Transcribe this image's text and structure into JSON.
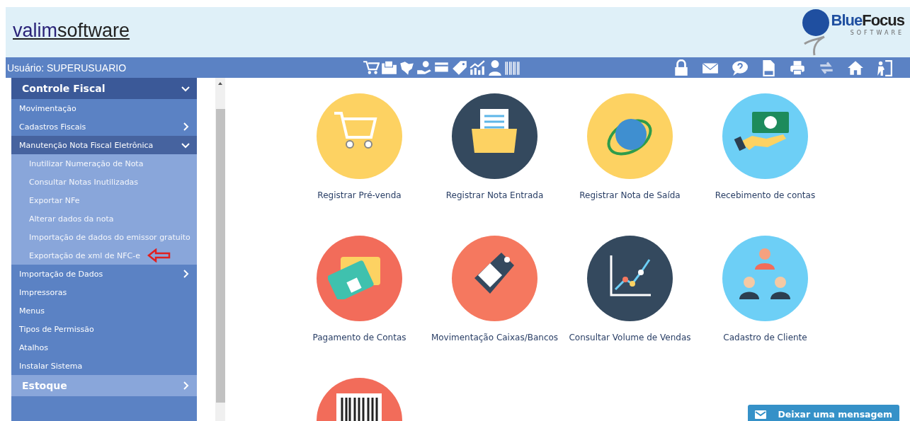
{
  "header": {
    "logo_left": {
      "part1": "valim",
      "part2": "software"
    },
    "logo_right": {
      "name_a": "Blue",
      "name_b": "Focus",
      "tagline": "SOFTWARE"
    }
  },
  "user_bar": {
    "user": "Usuário: SUPERUSUARIO",
    "center_icons": [
      {
        "kind": "cart"
      },
      {
        "kind": "folder"
      },
      {
        "kind": "map"
      },
      {
        "kind": "hand-coin"
      },
      {
        "kind": "card"
      },
      {
        "kind": "tag"
      },
      {
        "kind": "chart"
      },
      {
        "kind": "person"
      },
      {
        "kind": "barcode"
      }
    ],
    "right_icons": [
      {
        "kind": "lock"
      },
      {
        "kind": "mail"
      },
      {
        "kind": "help"
      },
      {
        "kind": "sql"
      },
      {
        "kind": "printer"
      },
      {
        "kind": "swap"
      },
      {
        "kind": "home"
      },
      {
        "kind": "exit"
      }
    ]
  },
  "sidebar": {
    "items": [
      {
        "kind": "section",
        "label": "Controle Fiscal",
        "expanded": true
      },
      {
        "kind": "item",
        "label": "Movimentação"
      },
      {
        "kind": "item",
        "label": "Cadastros Fiscais",
        "expanded": false
      },
      {
        "kind": "group",
        "label": "Manutenção Nota Fiscal Eletrônica",
        "expanded": true,
        "children": [
          {
            "label": "Inutilizar Numeração de Nota",
            "arrow": false
          },
          {
            "label": "Consultar Notas Inutilizadas",
            "arrow": false
          },
          {
            "label": "Exportar NFe",
            "arrow": false
          },
          {
            "label": "Alterar dados da nota",
            "arrow": false
          },
          {
            "label": "Importação de dados do emissor gratuito",
            "arrow": false
          },
          {
            "label": "Exportação de xml de NFC-e",
            "arrow": true
          }
        ]
      },
      {
        "kind": "item",
        "label": "Importação de Dados",
        "expanded": false
      },
      {
        "kind": "item",
        "label": "Impressoras"
      },
      {
        "kind": "item",
        "label": "Menus"
      },
      {
        "kind": "item",
        "label": "Tipos de Permissão"
      },
      {
        "kind": "item",
        "label": "Atalhos"
      },
      {
        "kind": "item",
        "label": "Instalar Sistema"
      },
      {
        "kind": "section",
        "label": "Estoque",
        "expanded": false
      }
    ]
  },
  "tiles": [
    {
      "kind": "cart",
      "label": "Registrar Pré-venda",
      "color": "#fdd262"
    },
    {
      "kind": "folder",
      "label": "Registrar Nota Entrada",
      "color": "#34495e"
    },
    {
      "kind": "nfe",
      "label": "Registrar Nota de Saída",
      "color": "#fdd262"
    },
    {
      "kind": "money",
      "label": "Recebimento de contas",
      "color": "#6dcff6"
    },
    {
      "kind": "card",
      "label": "Pagamento de Contas",
      "color": "#f26c5a"
    },
    {
      "kind": "tag",
      "label": "Movimentação Caixas/Bancos",
      "color": "#f5785f"
    },
    {
      "kind": "chart",
      "label": "Consultar Volume de Vendas",
      "color": "#34495e"
    },
    {
      "kind": "people",
      "label": "Cadastro de Cliente",
      "color": "#6dcff6"
    },
    {
      "kind": "barcode",
      "color": "#f26c5a"
    }
  ],
  "chat_button": {
    "label": "Deixar uma mensagem"
  }
}
